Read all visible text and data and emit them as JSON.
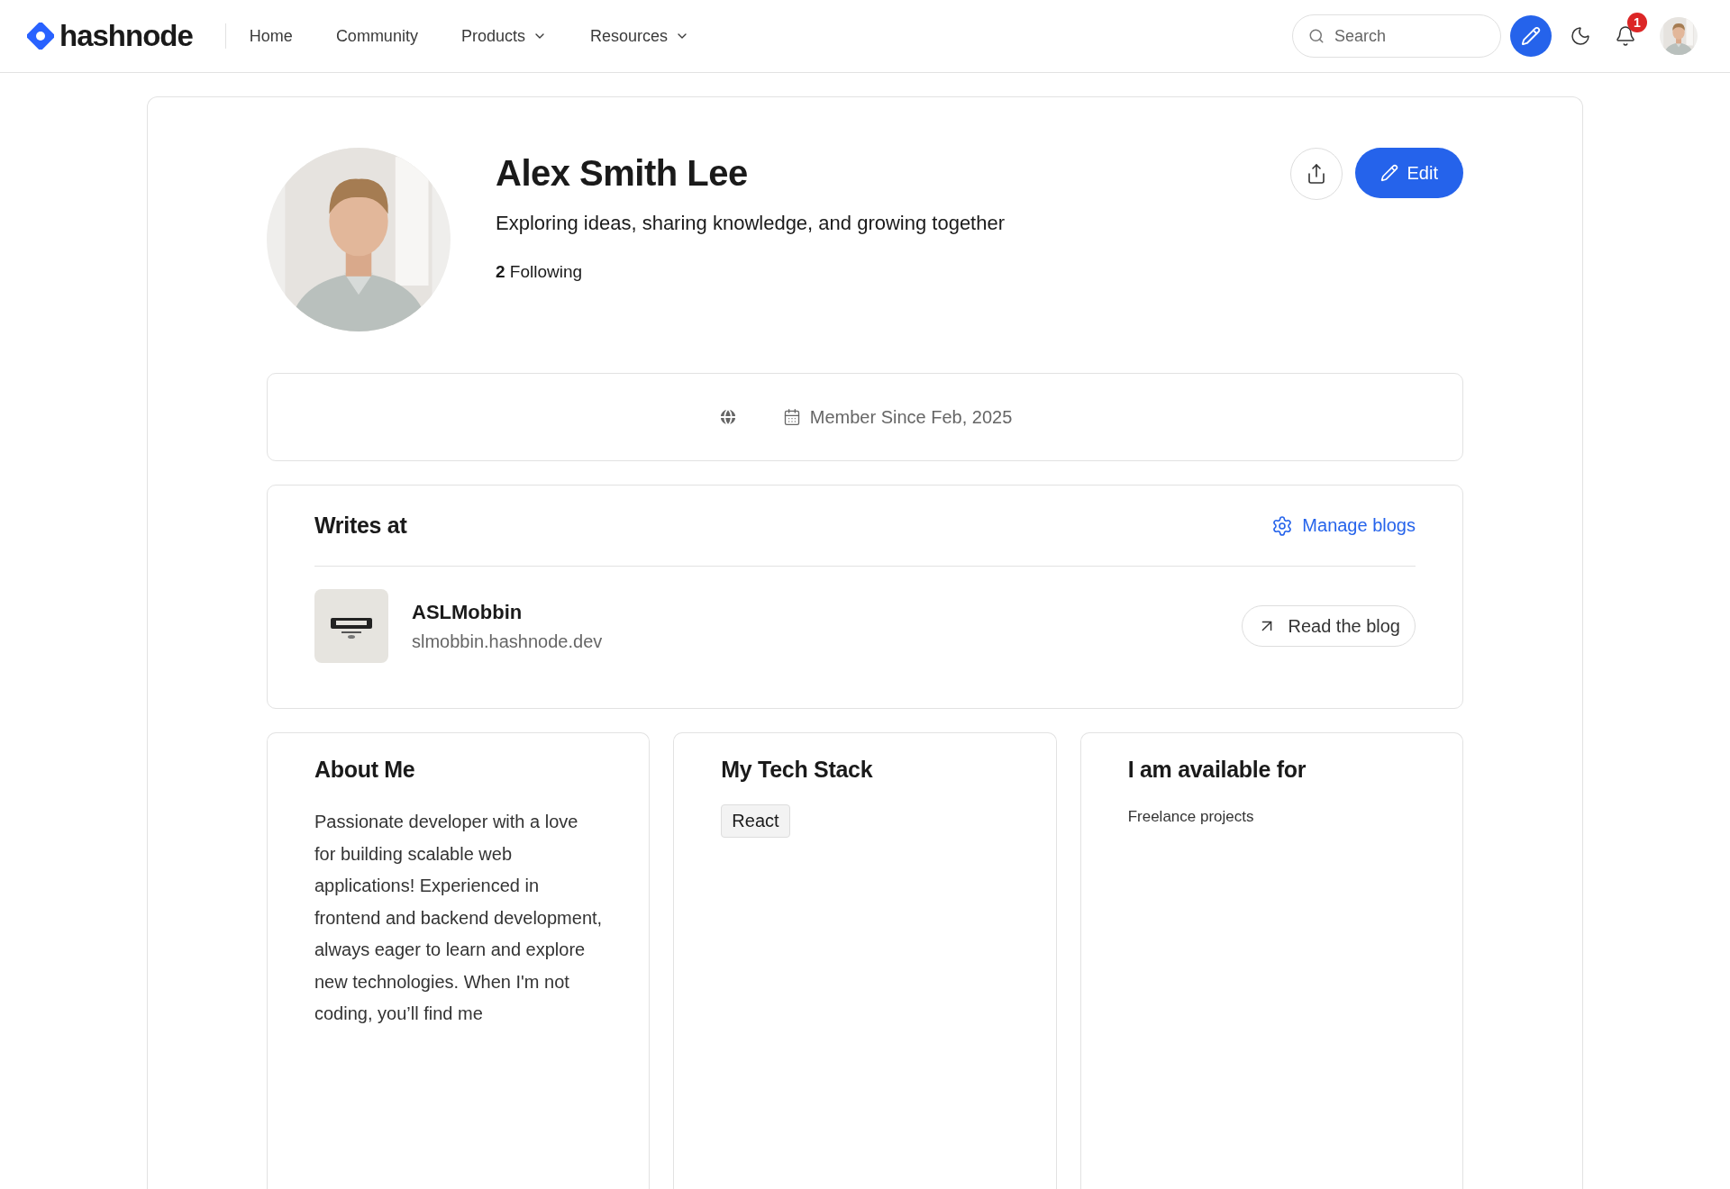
{
  "nav": {
    "logo": "hashnode",
    "links": [
      {
        "label": "Home",
        "dropdown": false
      },
      {
        "label": "Community",
        "dropdown": false
      },
      {
        "label": "Products",
        "dropdown": true
      },
      {
        "label": "Resources",
        "dropdown": true
      }
    ],
    "search": {
      "placeholder": "Search"
    },
    "notifications": "1"
  },
  "profile": {
    "name": "Alex Smith Lee",
    "tagline": "Exploring ideas, sharing knowledge, and growing together",
    "following_count": "2",
    "following_label": "Following",
    "edit_label": "Edit"
  },
  "meta": {
    "member_since": "Member Since Feb, 2025"
  },
  "writes_at": {
    "title": "Writes at",
    "manage": "Manage blogs",
    "blogs": [
      {
        "name": "ASLMobbin",
        "url": "slmobbin.hashnode.dev",
        "action": "Read the blog"
      }
    ]
  },
  "about": {
    "title": "About Me",
    "text": "Passionate developer with a love for building scalable web applications! Experienced in frontend and backend development, always eager to learn and explore new technologies. When I'm not coding, you’ll find me"
  },
  "tech_stack": {
    "title": "My Tech Stack",
    "items": [
      "React"
    ]
  },
  "available": {
    "title": "I am available for",
    "text": "Freelance projects"
  }
}
